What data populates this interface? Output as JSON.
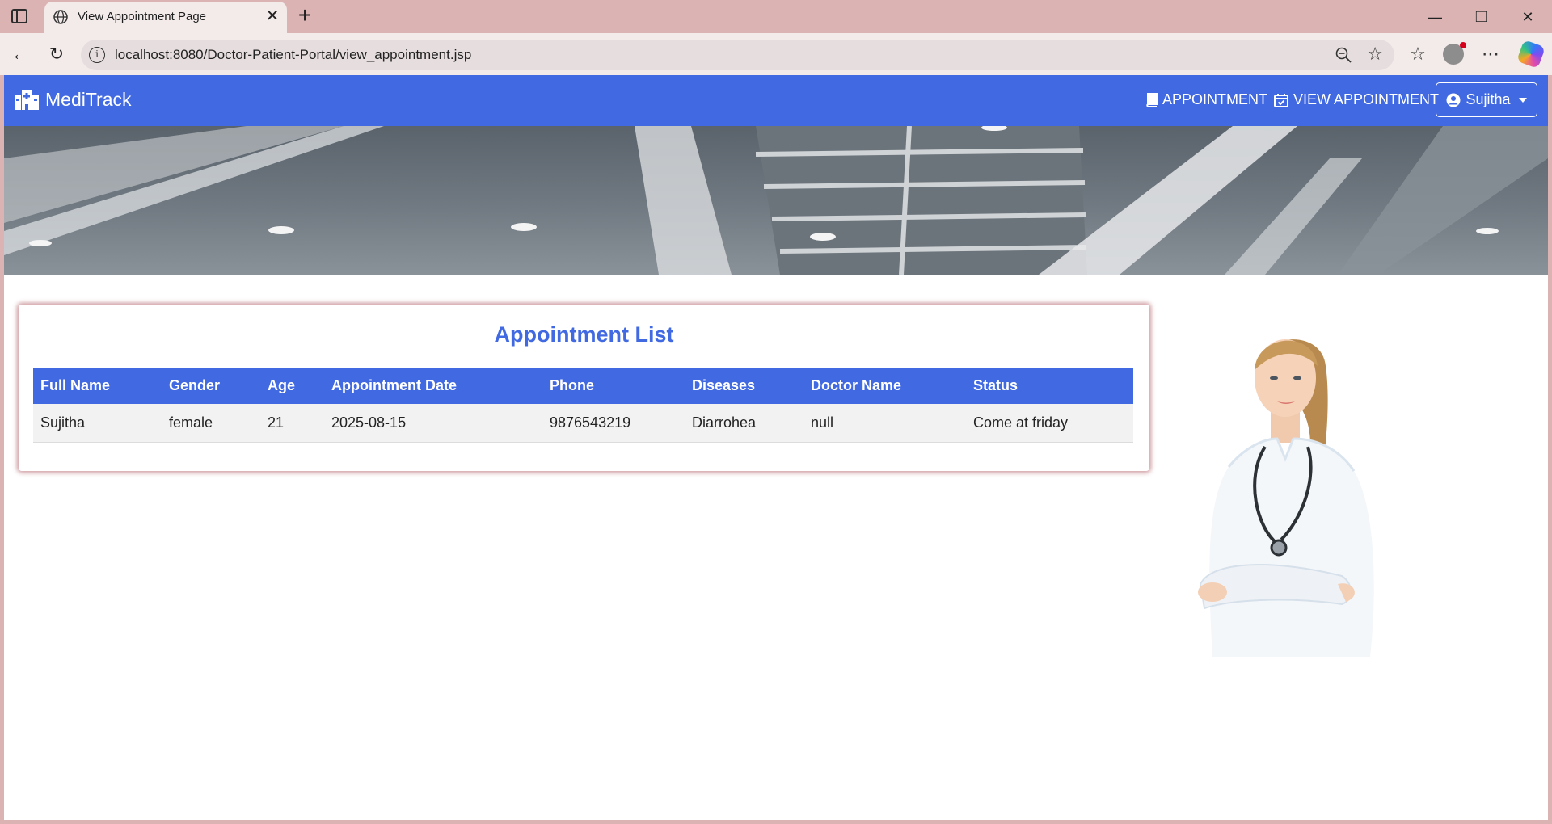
{
  "browser": {
    "tab_title": "View Appointment Page",
    "url": "localhost:8080/Doctor-Patient-Portal/view_appointment.jsp"
  },
  "navbar": {
    "brand": "MediTrack",
    "links": [
      {
        "label": "APPOINTMENT",
        "icon": "book-icon"
      },
      {
        "label": "VIEW APPOINTMENT",
        "icon": "calendar-check-icon"
      }
    ],
    "user": "Sujitha",
    "color": "#4169e1"
  },
  "card": {
    "title": "Appointment List",
    "columns": [
      "Full Name",
      "Gender",
      "Age",
      "Appointment Date",
      "Phone",
      "Diseases",
      "Doctor Name",
      "Status"
    ],
    "rows": [
      [
        "Sujitha",
        "female",
        "21",
        "2025-08-15",
        "9876543219",
        "Diarrohea",
        "null",
        "Come at friday"
      ]
    ]
  }
}
